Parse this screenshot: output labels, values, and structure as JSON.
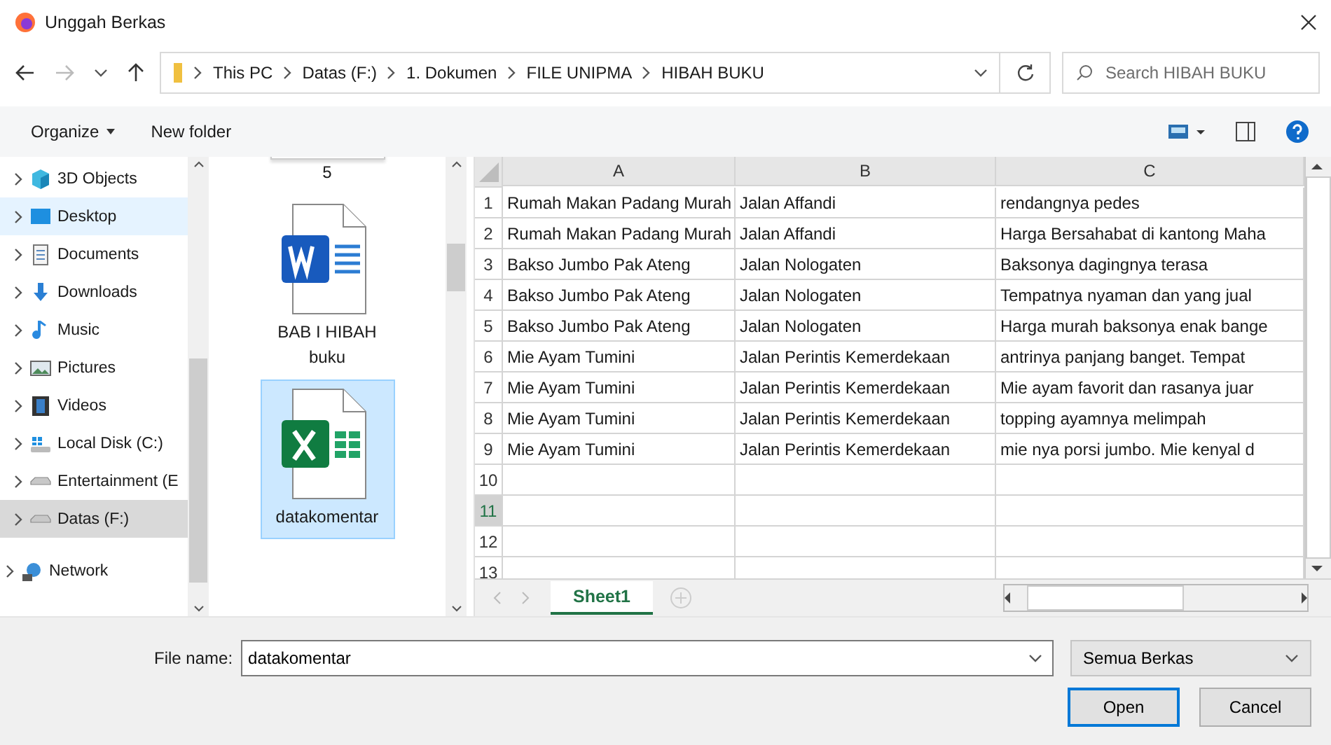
{
  "window": {
    "title": "Unggah Berkas"
  },
  "address_bar": {
    "path": [
      "This PC",
      "Datas (F:)",
      "1. Dokumen",
      "FILE UNIPMA",
      "HIBAH BUKU"
    ]
  },
  "search": {
    "placeholder": "Search HIBAH BUKU"
  },
  "toolbar": {
    "organize": "Organize",
    "new_folder": "New folder"
  },
  "nav_pane": {
    "items": [
      {
        "label": "3D Objects",
        "kind": "objects",
        "hovered": false,
        "selected": false
      },
      {
        "label": "Desktop",
        "kind": "desktop",
        "hovered": true,
        "selected": false
      },
      {
        "label": "Documents",
        "kind": "documents",
        "hovered": false,
        "selected": false
      },
      {
        "label": "Downloads",
        "kind": "downloads",
        "hovered": false,
        "selected": false
      },
      {
        "label": "Music",
        "kind": "music",
        "hovered": false,
        "selected": false
      },
      {
        "label": "Pictures",
        "kind": "pictures",
        "hovered": false,
        "selected": false
      },
      {
        "label": "Videos",
        "kind": "videos",
        "hovered": false,
        "selected": false
      },
      {
        "label": "Local Disk (C:)",
        "kind": "system_disk",
        "hovered": false,
        "selected": false
      },
      {
        "label": "Entertainment (E",
        "kind": "drive",
        "hovered": false,
        "selected": false
      },
      {
        "label": "Datas (F:)",
        "kind": "drive",
        "hovered": false,
        "selected": true
      },
      {
        "label": "Network",
        "kind": "network",
        "hovered": false,
        "selected": false
      }
    ]
  },
  "files": [
    {
      "label": "5",
      "kind": "partial",
      "selected": false
    },
    {
      "label": "BAB I HIBAH buku",
      "kind": "word",
      "selected": false
    },
    {
      "label": "datakomentar",
      "kind": "excel",
      "selected": true
    }
  ],
  "preview": {
    "columns": [
      "A",
      "B",
      "C"
    ],
    "rows": [
      {
        "number": "1",
        "selected": false,
        "cells": [
          "Rumah Makan Padang Murah",
          "Jalan Affandi",
          "rendangnya pedes"
        ]
      },
      {
        "number": "2",
        "selected": false,
        "cells": [
          "Rumah Makan Padang Murah",
          "Jalan Affandi",
          "Harga Bersahabat di kantong Maha"
        ]
      },
      {
        "number": "3",
        "selected": false,
        "cells": [
          "Bakso Jumbo Pak Ateng",
          "Jalan Nologaten",
          "Baksonya dagingnya terasa"
        ]
      },
      {
        "number": "4",
        "selected": false,
        "cells": [
          "Bakso Jumbo Pak Ateng",
          "Jalan Nologaten",
          "Tempatnya nyaman dan yang jual"
        ]
      },
      {
        "number": "5",
        "selected": false,
        "cells": [
          "Bakso Jumbo Pak Ateng",
          "Jalan Nologaten",
          "Harga murah baksonya enak bange"
        ]
      },
      {
        "number": "6",
        "selected": false,
        "cells": [
          "Mie Ayam Tumini",
          "Jalan Perintis Kemerdekaan",
          "antrinya panjang banget. Tempat"
        ]
      },
      {
        "number": "7",
        "selected": false,
        "cells": [
          "Mie Ayam Tumini",
          "Jalan Perintis Kemerdekaan",
          "Mie ayam favorit dan rasanya juar"
        ]
      },
      {
        "number": "8",
        "selected": false,
        "cells": [
          "Mie Ayam Tumini",
          "Jalan Perintis Kemerdekaan",
          "topping ayamnya melimpah"
        ]
      },
      {
        "number": "9",
        "selected": false,
        "cells": [
          "Mie Ayam Tumini",
          "Jalan Perintis Kemerdekaan",
          "mie nya porsi jumbo. Mie kenyal d"
        ]
      },
      {
        "number": "10",
        "selected": false,
        "cells": []
      },
      {
        "number": "11",
        "selected": true,
        "cells": []
      },
      {
        "number": "12",
        "selected": false,
        "cells": []
      },
      {
        "number": "13",
        "selected": false,
        "cells": []
      }
    ],
    "sheet_tabs": [
      {
        "label": "Sheet1",
        "selected": true
      }
    ]
  },
  "file_name": {
    "label": "File name:",
    "value": "datakomentar"
  },
  "file_type": {
    "value": "Semua Berkas"
  },
  "buttons": [
    {
      "label": "Open",
      "default": true
    },
    {
      "label": "Cancel",
      "default": false
    }
  ]
}
